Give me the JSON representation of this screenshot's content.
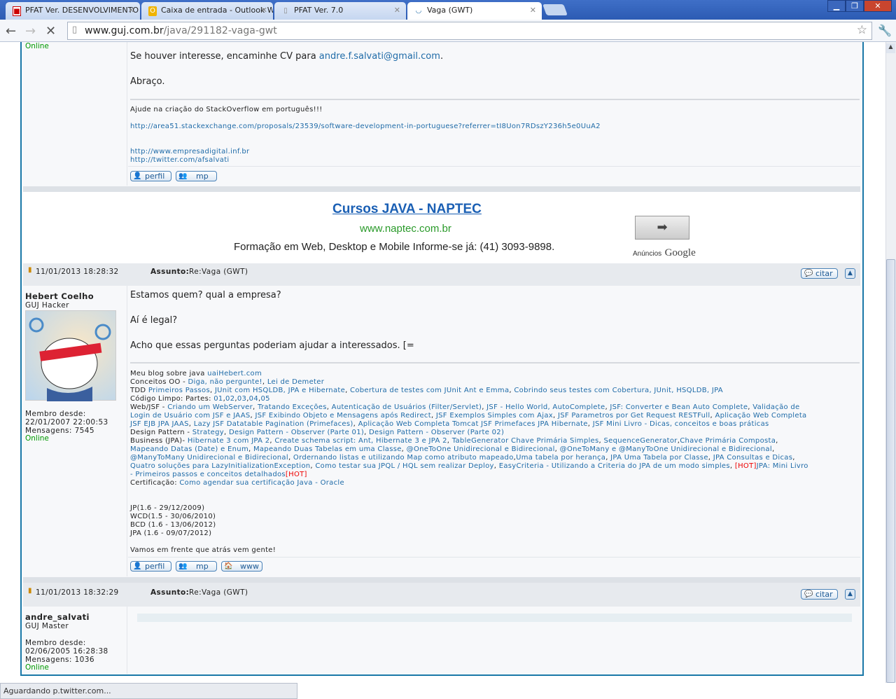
{
  "browser": {
    "tabs": [
      {
        "title": "PFAT Ver. DESENVOLVIMENTO",
        "icon": "pfat-icon"
      },
      {
        "title": "Caixa de entrada - Outlook Web",
        "icon": "outlook-icon"
      },
      {
        "title": "PFAT Ver. 7.0",
        "icon": "page-icon"
      },
      {
        "title": "Vaga (GWT)",
        "icon": "loading-icon"
      }
    ],
    "url_host": "www.guj.com.br",
    "url_path": "/java/291182-vaga-gwt",
    "status": "Aguardando p.twitter.com..."
  },
  "post1": {
    "online": "Online",
    "lines": [
      {
        "text": "Se houver interesse, encaminhe CV para ",
        "link": "andre.f.salvati@gmail.com",
        "after": "."
      },
      {
        "text": "Abraço."
      }
    ],
    "signature": {
      "intro": "Ajude na criação do StackOverflow em português!!!",
      "links": [
        "http://area51.stackexchange.com/proposals/23539/software-development-in-portuguese?referrer=tI8Uon7RDszY236h5e0UuA2",
        "http://www.empresadigital.inf.br",
        "http://twitter.com/afsalvati"
      ]
    },
    "buttons": {
      "perfil": "perfil",
      "mp": "mp"
    }
  },
  "ad": {
    "title": "Cursos JAVA - NAPTEC",
    "url": "www.naptec.com.br",
    "description": "Formação em Web, Desktop e Mobile Informe-se já: (41) 3093-9898.",
    "ads_label": "Anúncios",
    "ads_brand": "Google"
  },
  "post2": {
    "date": "11/01/2013 18:28:32",
    "subject_label": "Assunto:",
    "subject": "Re:Vaga (GWT)",
    "citar": "citar",
    "author": "Hebert Coelho",
    "rank": "GUJ Hacker",
    "member_since_label": "Membro desde:",
    "member_since": "22/01/2007 22:00:53",
    "messages": "Mensagens: 7545",
    "online": "Online",
    "body": [
      "Estamos quem? qual a empresa?",
      "Aí é legal?",
      "Acho que essas perguntas poderiam ajudar a interessados. [="
    ],
    "signature": [
      [
        {
          "t": "Meu blog sobre java "
        },
        {
          "t": "uaiHebert.com",
          "l": 1
        }
      ],
      [
        {
          "t": "Conceitos OO - "
        },
        {
          "t": "Diga, não pergunte!",
          "l": 1
        },
        {
          "t": ", "
        },
        {
          "t": "Lei de Demeter",
          "l": 1
        }
      ],
      [
        {
          "t": "TDD "
        },
        {
          "t": "Primeiros Passos",
          "l": 1
        },
        {
          "t": ", "
        },
        {
          "t": "JUnit com HSQLDB, JPA e Hibernate",
          "l": 1
        },
        {
          "t": ", "
        },
        {
          "t": "Cobertura de testes com JUnit Ant e Emma",
          "l": 1
        },
        {
          "t": ", "
        },
        {
          "t": "Cobrindo seus testes com Cobertura, JUnit, HSQLDB, JPA",
          "l": 1
        }
      ],
      [
        {
          "t": "Código Limpo: Partes: "
        },
        {
          "t": "01",
          "l": 1
        },
        {
          "t": ","
        },
        {
          "t": "02",
          "l": 1
        },
        {
          "t": ","
        },
        {
          "t": "03",
          "l": 1
        },
        {
          "t": ","
        },
        {
          "t": "04",
          "l": 1
        },
        {
          "t": ","
        },
        {
          "t": "05",
          "l": 1
        }
      ],
      [
        {
          "t": "Web/JSF - "
        },
        {
          "t": "Criando um WebServer",
          "l": 1
        },
        {
          "t": ", "
        },
        {
          "t": "Tratando Exceções",
          "l": 1
        },
        {
          "t": ", "
        },
        {
          "t": "Autenticação de Usuários (Filter/Servlet)",
          "l": 1
        },
        {
          "t": ", "
        },
        {
          "t": "JSF - Hello World, AutoComplete",
          "l": 1
        },
        {
          "t": ", "
        },
        {
          "t": "JSF: Converter e Bean Auto Complete",
          "l": 1
        },
        {
          "t": ", "
        },
        {
          "t": "Validação de",
          "l": 1
        }
      ],
      [
        {
          "t": "Login de Usuário com JSF e JAAS",
          "l": 1
        },
        {
          "t": ", "
        },
        {
          "t": "JSF Exibindo Objeto e Mensagens após Redirect",
          "l": 1
        },
        {
          "t": ", "
        },
        {
          "t": "JSF Exemplos Simples com Ajax",
          "l": 1
        },
        {
          "t": ", "
        },
        {
          "t": "JSF Parametros por Get Request RESTFull",
          "l": 1
        },
        {
          "t": ", "
        },
        {
          "t": "Aplicação Web Completa",
          "l": 1
        }
      ],
      [
        {
          "t": "JSF EJB JPA JAAS",
          "l": 1
        },
        {
          "t": ", "
        },
        {
          "t": "Lazy JSF Datatable Pagination (Primefaces)",
          "l": 1
        },
        {
          "t": ", "
        },
        {
          "t": "Aplicação Web Completa Tomcat JSF Primefaces JPA Hibernate",
          "l": 1
        },
        {
          "t": ", "
        },
        {
          "t": "JSF Mini Livro - Dicas, conceitos e boas práticas",
          "l": 1
        }
      ],
      [
        {
          "t": "Design Pattern - "
        },
        {
          "t": "Strategy",
          "l": 1
        },
        {
          "t": ", "
        },
        {
          "t": "Design Pattern - Observer (Parte 01)",
          "l": 1
        },
        {
          "t": ", "
        },
        {
          "t": "Design Pattern - Observer (Parte 02)",
          "l": 1
        }
      ],
      [
        {
          "t": "Business (JPA)- "
        },
        {
          "t": "Hibernate 3 com JPA 2",
          "l": 1
        },
        {
          "t": ", "
        },
        {
          "t": "Create schema script: Ant, Hibernate 3 e JPA 2",
          "l": 1
        },
        {
          "t": ", "
        },
        {
          "t": "TableGenerator Chave Primária Simples",
          "l": 1
        },
        {
          "t": ", "
        },
        {
          "t": "SequenceGenerator",
          "l": 1
        },
        {
          "t": ","
        },
        {
          "t": "Chave Primária Composta",
          "l": 1
        },
        {
          "t": ","
        }
      ],
      [
        {
          "t": "Mapeando Datas (Date) e Enum",
          "l": 1
        },
        {
          "t": ", "
        },
        {
          "t": "Mapeando Duas Tabelas em uma Classe",
          "l": 1
        },
        {
          "t": ", "
        },
        {
          "t": "@OneToOne Unidirecional e Bidirecional",
          "l": 1
        },
        {
          "t": ", "
        },
        {
          "t": "@OneToMany e @ManyToOne Unidirecional e Bidirecional",
          "l": 1
        },
        {
          "t": ","
        }
      ],
      [
        {
          "t": "@ManyToMany Unidirecional e Bidirecional",
          "l": 1
        },
        {
          "t": ", "
        },
        {
          "t": "Ordernando listas e utilizando Map como atributo mapeado",
          "l": 1
        },
        {
          "t": ","
        },
        {
          "t": "Uma tabela por herança",
          "l": 1
        },
        {
          "t": ", "
        },
        {
          "t": "JPA Uma Tabela por Classe",
          "l": 1
        },
        {
          "t": ", "
        },
        {
          "t": "JPA Consultas e Dicas",
          "l": 1
        },
        {
          "t": ","
        }
      ],
      [
        {
          "t": "Quatro soluções para LazyInitializationException",
          "l": 1
        },
        {
          "t": ", "
        },
        {
          "t": "Como testar sua JPQL / HQL sem realizar Deploy",
          "l": 1
        },
        {
          "t": ", "
        },
        {
          "t": "EasyCriteria - Utilizando a Criteria do JPA de um modo simples",
          "l": 1
        },
        {
          "t": ", "
        },
        {
          "t": "[HOT]",
          "h": 1
        },
        {
          "t": "JPA: Mini Livro",
          "l": 1
        }
      ],
      [
        {
          "t": "- Primeiros passos e conceitos detalhados",
          "l": 1
        },
        {
          "t": "[HOT]",
          "h": 1
        }
      ],
      [
        {
          "t": "Certificação: "
        },
        {
          "t": "Como agendar sua certificação Java - Oracle",
          "l": 1
        }
      ]
    ],
    "certs": [
      "JP(1.6 - 29/12/2009)",
      "WCD(1.5 - 30/06/2010)",
      "BCD (1.6 - 13/06/2012)",
      "JPA (1.6 - 09/07/2012)"
    ],
    "closing": "Vamos em frente que atrás vem gente!",
    "buttons": {
      "perfil": "perfil",
      "mp": "mp",
      "www": "www"
    }
  },
  "post3": {
    "date": "11/01/2013 18:32:29",
    "subject_label": "Assunto:",
    "subject": "Re:Vaga (GWT)",
    "citar": "citar",
    "author": "andre_salvati",
    "rank": "GUJ Master",
    "member_since_label": "Membro desde:",
    "member_since": "02/06/2005 16:28:38",
    "messages": "Mensagens: 1036",
    "online": "Online"
  }
}
